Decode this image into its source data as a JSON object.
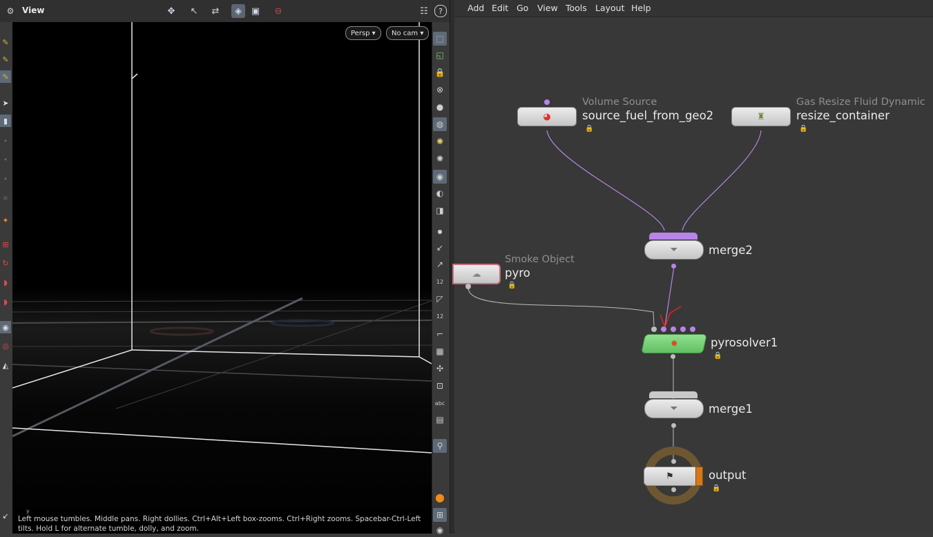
{
  "viewer": {
    "title": "View",
    "persp_label": "Persp",
    "cam_label": "No cam",
    "help_glyph": "?",
    "status_text": "Left mouse tumbles. Middle pans. Right dollies. Ctrl+Alt+Left box-zooms. Ctrl+Right zooms. Spacebar-Ctrl-Left tilts. Hold L for alternate tumble, dolly, and zoom.",
    "axis_label": "y",
    "right_toolbar_text": [
      "12",
      "12",
      "abc"
    ]
  },
  "menu": {
    "items": [
      "Add",
      "Edit",
      "Go",
      "View",
      "Tools",
      "Layout",
      "Help"
    ]
  },
  "nodes": {
    "source": {
      "type": "Volume Source",
      "name": "source_fuel_from_geo2"
    },
    "resize": {
      "type": "Gas Resize Fluid Dynamic",
      "name": "resize_container"
    },
    "merge2": {
      "name": "merge2"
    },
    "pyro": {
      "type": "Smoke Object",
      "name": "pyro"
    },
    "pyrosolver": {
      "name": "pyrosolver1"
    },
    "merge1": {
      "name": "merge1"
    },
    "output": {
      "name": "output"
    }
  },
  "colors": {
    "wire_purple": "#b784e8",
    "wire_gray": "#bdbdbd",
    "solver_green": "#7fd37f",
    "output_ring": "#6d5732",
    "output_flag": "#d6781a",
    "annotation_red": "#e02020"
  }
}
